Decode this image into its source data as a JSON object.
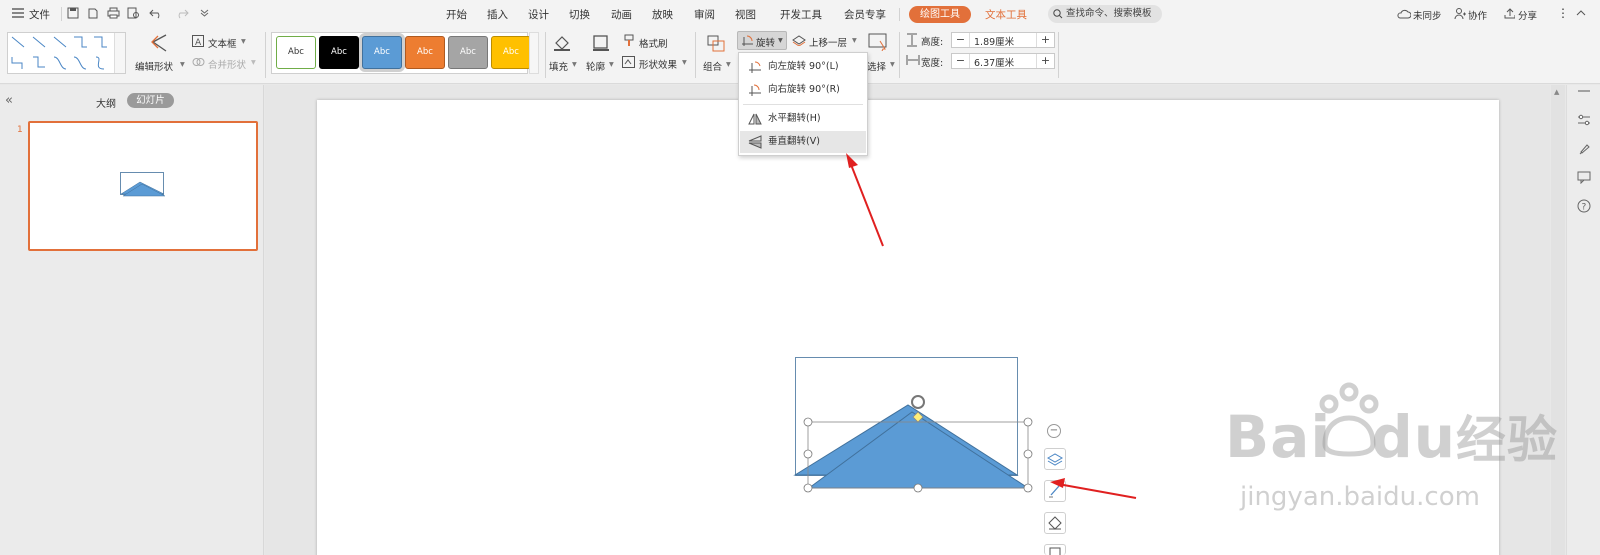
{
  "topbar": {
    "file_label": "文件",
    "menu": [
      "开始",
      "插入",
      "设计",
      "切换",
      "动画",
      "放映",
      "审阅",
      "视图",
      "开发工具",
      "会员专享"
    ],
    "drawing_tools": "绘图工具",
    "text_tools": "文本工具",
    "search_placeholder": "查找命令、搜索模板",
    "unsync": "未同步",
    "collab": "协作",
    "share": "分享"
  },
  "ribbon": {
    "edit_shape": "编辑形状",
    "textbox": "文本框",
    "merge_shape": "合并形状",
    "style_swatches": [
      {
        "label": "Abc",
        "bg": "#ffffff",
        "fg": "#333333",
        "border": "#70ad47"
      },
      {
        "label": "Abc",
        "bg": "#000000",
        "fg": "#ffffff",
        "border": "#000000"
      },
      {
        "label": "Abc",
        "bg": "#5b9bd5",
        "fg": "#ffffff",
        "border": "#41719c"
      },
      {
        "label": "Abc",
        "bg": "#ed7d31",
        "fg": "#ffffff",
        "border": "#ae5a21"
      },
      {
        "label": "Abc",
        "bg": "#a5a5a5",
        "fg": "#ffffff",
        "border": "#787878"
      },
      {
        "label": "Abc",
        "bg": "#ffc000",
        "fg": "#ffffff",
        "border": "#bc8c00"
      }
    ],
    "fill": "填充",
    "outline": "轮廓",
    "format_painter": "格式刷",
    "shape_effect": "形状效果",
    "group": "组合",
    "rotate": "旋转",
    "bring_forward": "上移一层",
    "select": "选择",
    "height_label": "高度:",
    "height_value": "1.89厘米",
    "width_label": "宽度:",
    "width_value": "6.37厘米"
  },
  "rotate_menu": [
    {
      "label": "向左旋转 90°(L)",
      "icon": "rotate-left-icon"
    },
    {
      "label": "向右旋转 90°(R)",
      "icon": "rotate-right-icon"
    },
    {
      "label": "水平翻转(H)",
      "icon": "flip-horizontal-icon"
    },
    {
      "label": "垂直翻转(V)",
      "icon": "flip-vertical-icon"
    }
  ],
  "left_panel": {
    "outline_tab": "大纲",
    "slides_tab": "幻灯片",
    "slide_number": "1"
  },
  "watermark": {
    "brand": "Bai",
    "brand2": "du",
    "cn": "经验",
    "url": "jingyan.baidu.com"
  },
  "colors": {
    "accent": "#e2703a",
    "shape_fill": "#5b9bd5",
    "shape_stroke": "#41719c",
    "arrow": "#e02020"
  }
}
